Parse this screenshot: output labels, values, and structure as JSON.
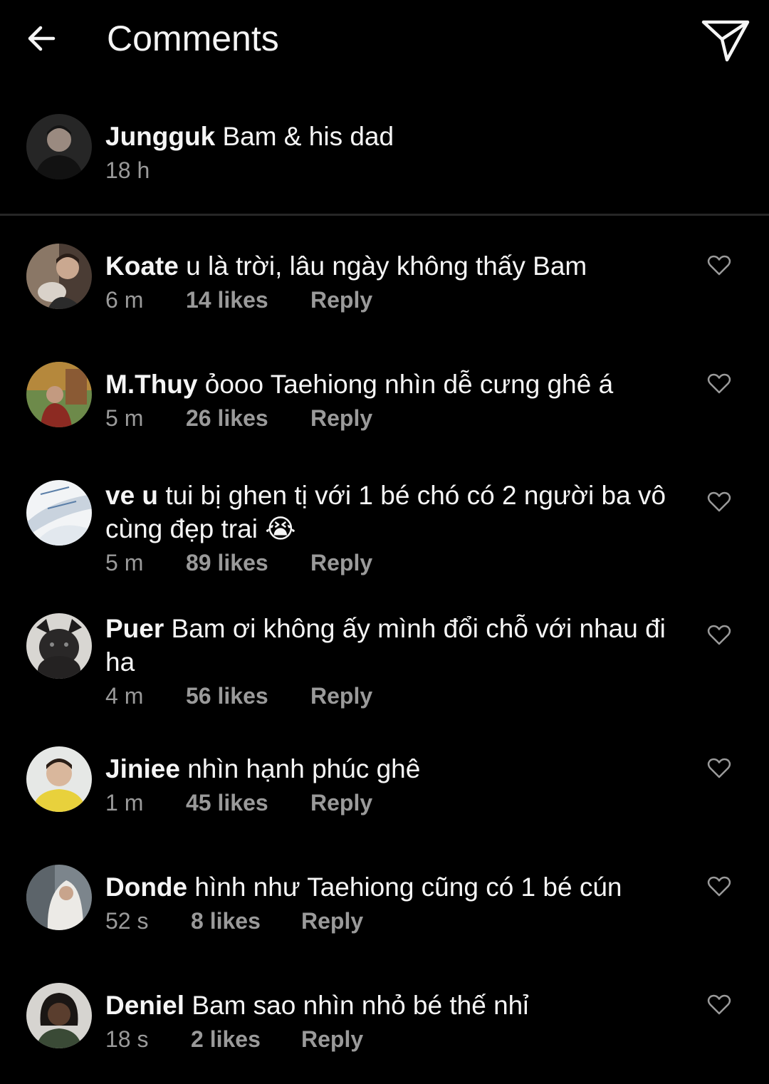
{
  "header": {
    "back_icon": "arrow-left-icon",
    "title": "Comments",
    "send_icon": "paper-plane-icon"
  },
  "caption": {
    "username": "Jungguk",
    "text": "Bam & his dad",
    "time": "18 h",
    "avatar_color": "#3a3a3a"
  },
  "comments": [
    {
      "username": "Koate",
      "text": "u là trời, lâu ngày không thấy Bam",
      "time": "6 m",
      "likes": "14 likes",
      "reply": "Reply",
      "avatar_color": "#8a7766"
    },
    {
      "username": "M.Thuy",
      "text": "ỏooo Taehiong nhìn dễ cưng ghê á",
      "time": "5 m",
      "likes": "26 likes",
      "reply": "Reply",
      "avatar_color": "#a06a3c"
    },
    {
      "username": "ve u",
      "text": "tui bị ghen tị với 1 bé chó có 2 người ba vô cùng đẹp trai 😭",
      "time": "5 m",
      "likes": "89 likes",
      "reply": "Reply",
      "avatar_color": "#dfe6ee"
    },
    {
      "username": "Puer",
      "text": "Bam ơi không ấy mình đổi chỗ với nhau đi ha",
      "time": "4 m",
      "likes": "56 likes",
      "reply": "Reply",
      "avatar_color": "#2c2a2a"
    },
    {
      "username": "Jiniee",
      "text": "nhìn hạnh phúc ghê",
      "time": "1 m",
      "likes": "45 likes",
      "reply": "Reply",
      "avatar_color": "#d8c84a"
    },
    {
      "username": "Donde",
      "text": "hình như Taehiong cũng có 1 bé cún",
      "time": "52 s",
      "likes": "8 likes",
      "reply": "Reply",
      "avatar_color": "#9aa0a6"
    },
    {
      "username": "Deniel",
      "text": "Bam sao nhìn nhỏ bé thế nhỉ",
      "time": "18 s",
      "likes": "2 likes",
      "reply": "Reply",
      "avatar_color": "#5a5048"
    }
  ],
  "like_icon": "heart-outline-icon",
  "colors": {
    "background": "#000000",
    "text": "#f5f5f5",
    "meta": "#9a9a9a",
    "divider": "#262626"
  }
}
